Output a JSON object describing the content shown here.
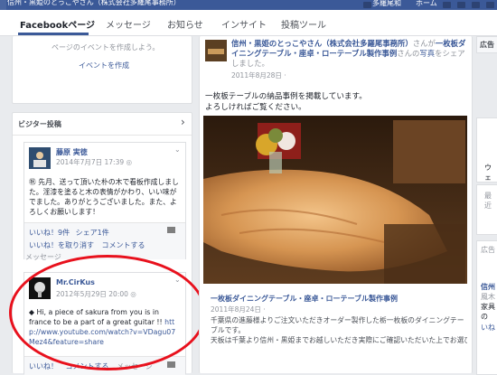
{
  "topbar": {
    "crumb": "信州・黒姫のとっこやさん（株式会社多羅尾事務所）",
    "user": "多羅尾和",
    "home": "ホーム"
  },
  "nav": {
    "tabs": [
      {
        "label": "Facebookページ"
      },
      {
        "label": "メッセージ"
      },
      {
        "label": "お知らせ"
      },
      {
        "label": "インサイト"
      },
      {
        "label": "投稿ツール"
      }
    ]
  },
  "events": {
    "text": "ページのイベントを作成しよう。",
    "link": "イベントを作成"
  },
  "visitor": {
    "header": "ビジター投稿",
    "chevron": "›",
    "post1": {
      "author": "藤原 実徳",
      "time": "2014年7月7日 17:39 ◎",
      "text": "㊗ 先月、送って頂いた朴の木で看板作成しました。淫漆を塗ると木の表情がかわり、いい味がでました。ありがとうございました。また、よろしくお願いします！",
      "likes": "いいね！9件",
      "shares": "シェア1件",
      "unlike": "いいね！を取り消す",
      "comment": "コメントする",
      "message": "メッセージ"
    },
    "post2": {
      "author": "Mr.CirKus",
      "time": "2012年5月29日 20:00 ◎",
      "text": "Hi, a piece of sakura from you is in france to be a part of a great guitar !!",
      "link": "http://www.youtube.com/watch?v=VDagu07Mez4&feature=share",
      "like": "いいね！",
      "comment": "コメントする",
      "message": "メッセージ"
    }
  },
  "main_post": {
    "page_name": "信州・黒姫のとっこやさん（株式会社多羅尾事務所）",
    "suffix_a": "さんが",
    "album_link": "一枚板ダイニングテーブル・座卓・ローテーブル製作事例",
    "suffix_b": "さんの",
    "photo_word": "写真",
    "suffix_c": "をシェアしました。",
    "time": "2011年8月28日 ·",
    "body_line1": "一枚板テーブルの納品事例を掲載しています。",
    "body_line2": "よろしければご覧ください。",
    "shared_title": "一枚板ダイニングテーブル・座卓・ローテーブル製作事例",
    "shared_time": "2011年8月24日 ·",
    "shared_text1": "千葉県の進藤様よりご注文いただきオーダー製作した栃一枚板のダイニングテーブルです。",
    "shared_text2": "天板は千葉より信州・黒姫までお越しいただき実際にご確認いただいた上でお選び"
  },
  "right": {
    "top": "広告",
    "a": "ウェ",
    "b": "最近",
    "c": "広告",
    "d": "信州",
    "e": "風木",
    "f": "家具の",
    "g": "いね"
  }
}
